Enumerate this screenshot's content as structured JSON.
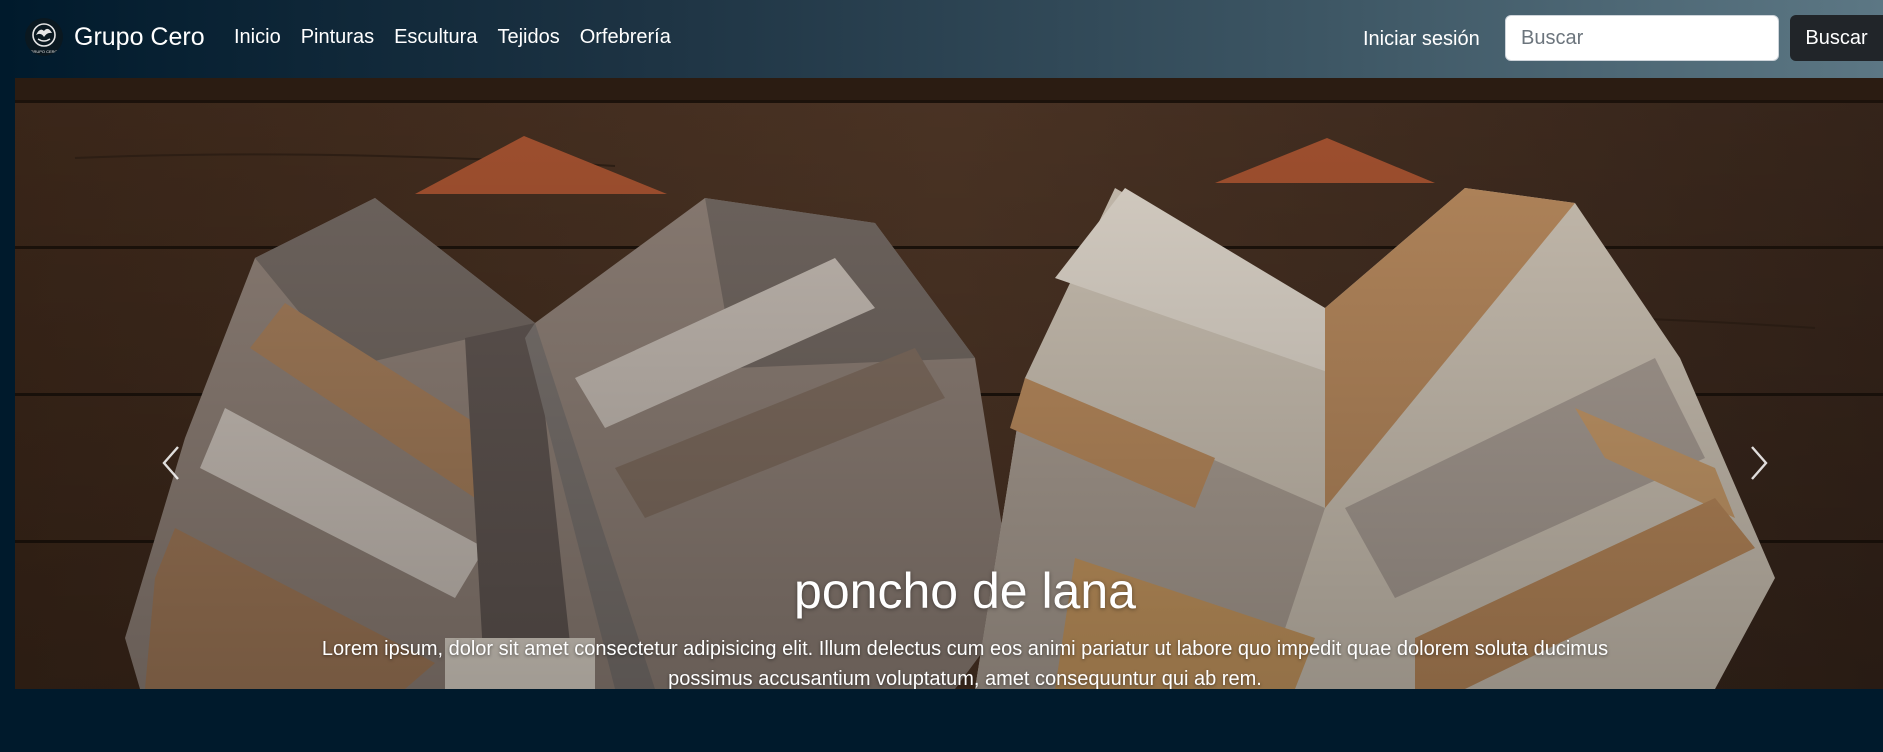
{
  "navbar": {
    "brand": "Grupo Cero",
    "logo_text": "GRUPO CERO",
    "links": [
      "Inicio",
      "Pinturas",
      "Escultura",
      "Tejidos",
      "Orfebrería"
    ],
    "login": "Iniciar sesión",
    "search": {
      "placeholder": "Buscar",
      "value": "",
      "button": "Buscar"
    }
  },
  "carousel": {
    "caption": {
      "title": "poncho de lana",
      "text": "Lorem ipsum, dolor sit amet consectetur adipisicing elit. Illum delectus cum eos animi pariatur ut labore quo impedit quae dolorem soluta ducimus possimus accusantium voluptatum, amet consequuntur qui ab rem."
    },
    "controls": {
      "prev_icon": "chevron-left-icon",
      "next_icon": "chevron-right-icon"
    }
  },
  "colors": {
    "page_background": "#001a2c",
    "search_button": "#212529",
    "nav_text": "#ffffff"
  }
}
